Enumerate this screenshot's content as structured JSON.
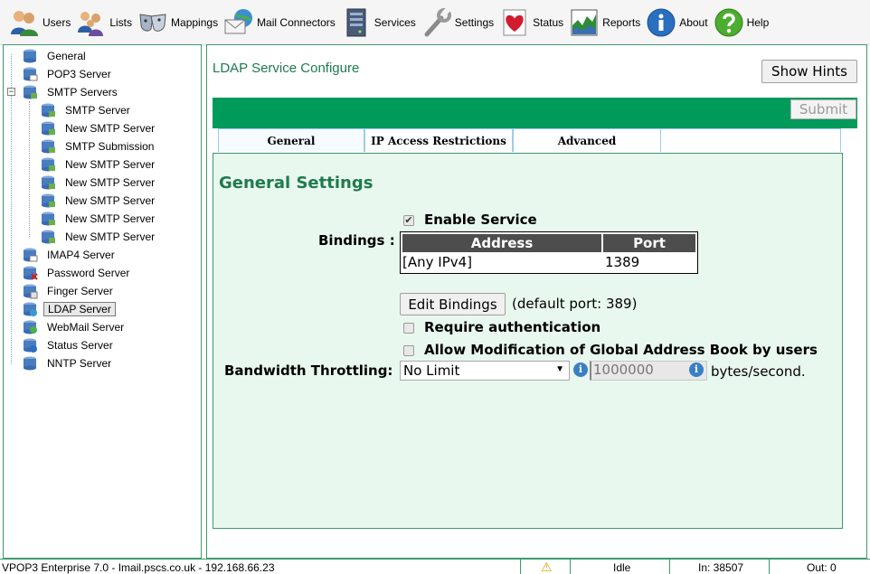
{
  "toolbar": {
    "items": [
      {
        "label": "Users",
        "icon": "users-icon"
      },
      {
        "label": "Lists",
        "icon": "lists-icon"
      },
      {
        "label": "Mappings",
        "icon": "masks-icon"
      },
      {
        "label": "Mail Connectors",
        "icon": "mail-connector-icon"
      },
      {
        "label": "Services",
        "icon": "server-icon"
      },
      {
        "label": "Settings",
        "icon": "wrench-icon"
      },
      {
        "label": "Status",
        "icon": "heart-icon"
      },
      {
        "label": "Reports",
        "icon": "chart-icon"
      },
      {
        "label": "About",
        "icon": "info-icon"
      },
      {
        "label": "Help",
        "icon": "help-icon"
      }
    ]
  },
  "tree": {
    "items": [
      {
        "label": "General"
      },
      {
        "label": "POP3 Server"
      },
      {
        "label": "SMTP Servers",
        "expander": "−"
      },
      {
        "label": "SMTP Server"
      },
      {
        "label": "New SMTP Server"
      },
      {
        "label": "SMTP Submission"
      },
      {
        "label": "New SMTP Server"
      },
      {
        "label": "New SMTP Server"
      },
      {
        "label": "New SMTP Server"
      },
      {
        "label": "New SMTP Server"
      },
      {
        "label": "New SMTP Server"
      },
      {
        "label": "IMAP4 Server"
      },
      {
        "label": "Password Server"
      },
      {
        "label": "Finger Server"
      },
      {
        "label": "LDAP Server",
        "selected": true
      },
      {
        "label": "WebMail Server"
      },
      {
        "label": "Status Server"
      },
      {
        "label": "NNTP Server"
      }
    ]
  },
  "main": {
    "title": "LDAP Service Configure",
    "show_hints_label": "Show Hints",
    "submit_label": "Submit",
    "tabs": [
      {
        "label": "General"
      },
      {
        "label": "IP Access Restrictions"
      },
      {
        "label": "Advanced"
      }
    ],
    "section_heading": "General Settings",
    "enable_service": {
      "label": "Enable Service",
      "checked": true,
      "mark": "✔"
    },
    "bindings": {
      "label": "Bindings :",
      "headers": [
        "Address",
        "Port"
      ],
      "rows": [
        [
          "[Any IPv4]",
          "1389"
        ]
      ]
    },
    "edit_bindings_label": "Edit Bindings",
    "default_port_text": "(default port: 389)",
    "require_auth": {
      "label": "Require authentication",
      "checked": false
    },
    "allow_mod": {
      "label": "Allow Modification of Global Address Book by users",
      "checked": false
    },
    "bandwidth": {
      "label": "Bandwidth Throttling:",
      "selected": "No Limit",
      "value": "1000000",
      "unit": "bytes/second.",
      "arrow": "▼",
      "info_glyph": "i"
    }
  },
  "status_bar": {
    "product": "VPOP3 Enterprise 7.0 - Imail.pscs.co.uk - 192.168.66.23",
    "warning_glyph": "⚠",
    "state": "Idle",
    "in": "In: 38507",
    "out": "Out: 0"
  },
  "colors": {
    "accent_green": "#009a5b",
    "heading_green": "#1e7a4f",
    "panel_bg": "#e9f8ee"
  }
}
